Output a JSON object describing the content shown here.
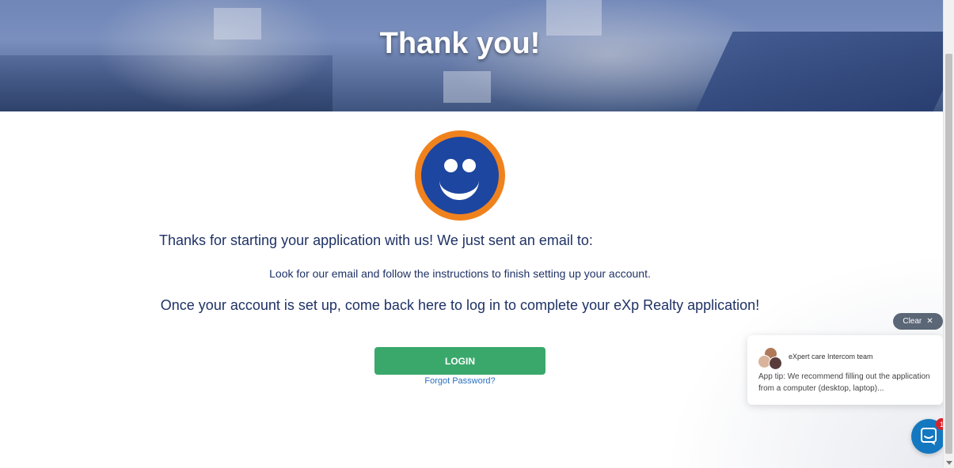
{
  "hero": {
    "title": "Thank you!"
  },
  "content": {
    "line1": "Thanks for starting your application with us! We just sent an email to:",
    "line2": "Look for our email and follow the instructions to finish setting up your account.",
    "line3": "Once your account is set up, come back here to log in to complete your eXp Realty application!",
    "login_label": "LOGIN",
    "forgot_label": "Forgot Password?"
  },
  "intercom": {
    "clear_label": "Clear",
    "clear_icon": "close-icon",
    "team_name": "eXpert care Intercom team",
    "tip": "App tip:  We recommend filling out the application from a computer (desktop, laptop)...",
    "badge_count": "1",
    "launcher_icon": "chat-icon"
  },
  "colors": {
    "login_green": "#3aa86b",
    "smiley_orange": "#f0821e",
    "smiley_blue": "#1d46a0",
    "text_navy": "#1f3266",
    "link_blue": "#2a6fc0",
    "launcher_blue": "#1478c0"
  }
}
